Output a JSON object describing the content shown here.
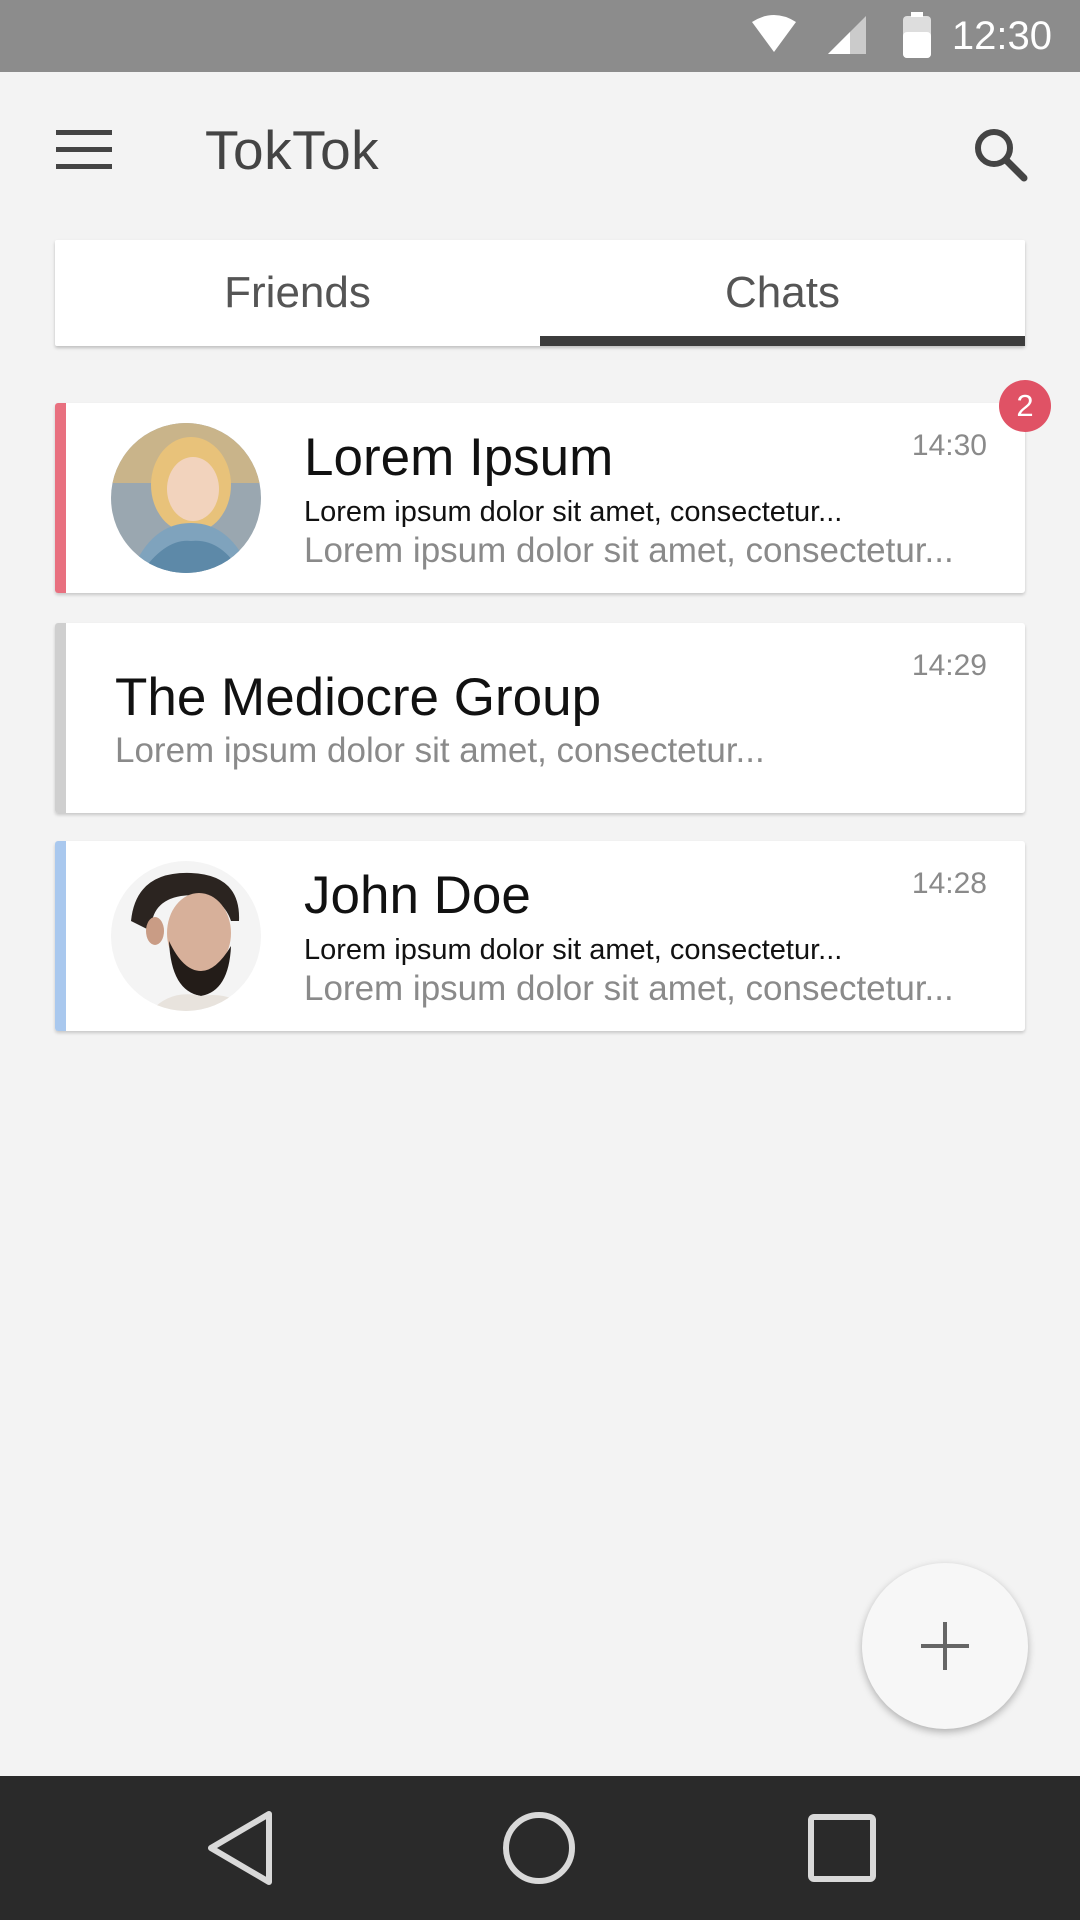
{
  "status_bar": {
    "time": "12:30",
    "icons": [
      "wifi-icon",
      "signal-icon",
      "battery-icon"
    ]
  },
  "app_bar": {
    "title": "TokTok",
    "menu_icon": "menu-icon",
    "search_icon": "search-icon"
  },
  "tabs": [
    {
      "label": "Friends",
      "selected": false
    },
    {
      "label": "Chats",
      "selected": true
    }
  ],
  "chats": [
    {
      "name": "Lorem Ipsum",
      "line1": "Lorem ipsum dolor sit amet, consectetur...",
      "line2": "Lorem ipsum dolor sit amet, consectetur...",
      "time": "14:30",
      "accent_color": "#e8707f",
      "unread_badge": "2",
      "has_avatar": true
    },
    {
      "name": "The Mediocre Group",
      "line1": "Lorem ipsum dolor sit amet, consectetur...",
      "time": "14:29",
      "accent_color": "#cfcfcf",
      "has_avatar": false
    },
    {
      "name": "John Doe",
      "line1": "Lorem ipsum dolor sit amet, consectetur...",
      "line2": "Lorem ipsum dolor sit amet, consectetur...",
      "time": "14:28",
      "accent_color": "#a9c8ee",
      "has_avatar": true
    }
  ],
  "fab": {
    "icon": "plus-icon"
  },
  "nav_bar": {
    "icons": [
      "back-icon",
      "home-icon",
      "recents-icon"
    ]
  },
  "colors": {
    "status_bar": "#8c8c8c",
    "background": "#f3f3f3",
    "badge": "#e05265",
    "nav_bar": "#2a2a2a"
  }
}
